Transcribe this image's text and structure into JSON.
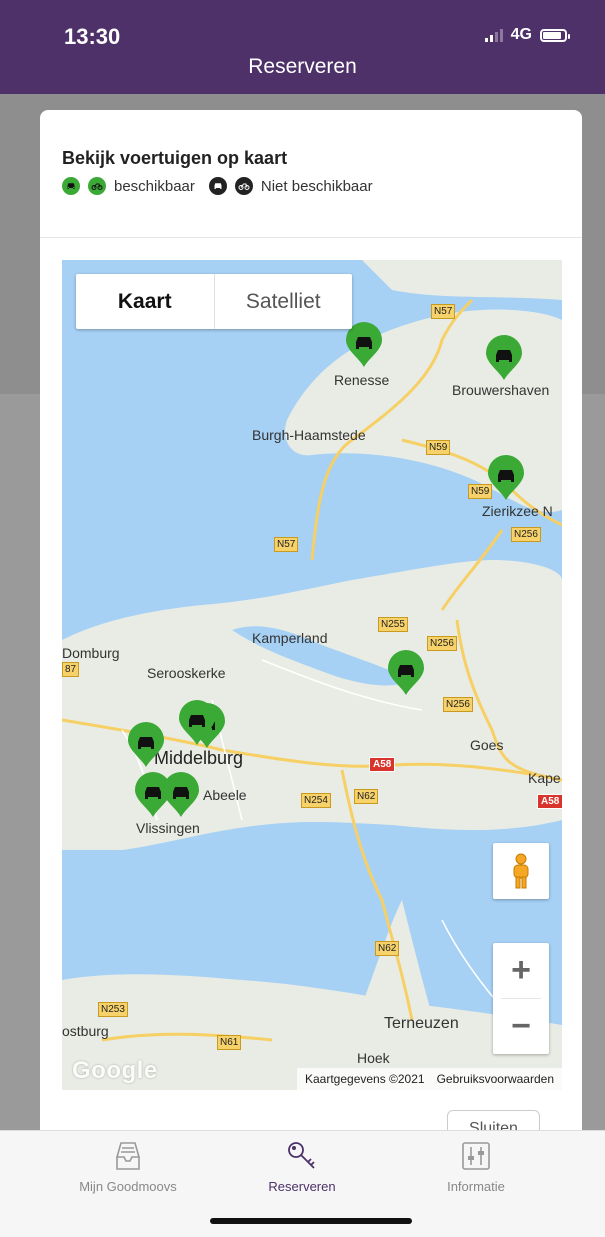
{
  "status_bar": {
    "time": "13:30",
    "network": "4G"
  },
  "nav": {
    "title": "Reserveren"
  },
  "card": {
    "title": "Bekijk voertuigen op kaart",
    "legend_available": "beschikbaar",
    "legend_unavailable": "Niet beschikbaar",
    "close_label": "Sluiten"
  },
  "map": {
    "type_map": "Kaart",
    "type_satellite": "Satelliet",
    "zoom_in": "+",
    "zoom_out": "−",
    "logo": "Google",
    "attribution": "Kaartgegevens ©2021",
    "terms": "Gebruiksvoorwaarden",
    "places": {
      "renesse": "Renesse",
      "brouwershaven": "Brouwershaven",
      "burgh": "Burgh-Haamstede",
      "zierikzee": "Zierikzee N",
      "kamperland": "Kamperland",
      "domburg": "Domburg",
      "serooskerke": "Serooskerke",
      "middelburg": "Middelburg",
      "goes": "Goes",
      "kape": "Kape",
      "abeele": "Abeele",
      "vlissingen": "Vlissingen",
      "terneuzen": "Terneuzen",
      "hoek": "Hoek",
      "ostburg": "ostburg"
    },
    "roads": {
      "n57a": "N57",
      "n57b": "N57",
      "n59a": "N59",
      "n59b": "N59",
      "n256a": "N256",
      "n256b": "N256",
      "n256c": "N256",
      "n255": "N255",
      "r87": "87",
      "a58a": "A58",
      "a58b": "A58",
      "n254": "N254",
      "n62a": "N62",
      "n62b": "N62",
      "n253": "N253",
      "n61": "N61"
    },
    "vehicle_status_color": "#3aa935"
  },
  "tabs": [
    {
      "label": "Mijn Goodmoovs",
      "icon": "inbox-icon"
    },
    {
      "label": "Reserveren",
      "icon": "key-icon"
    },
    {
      "label": "Informatie",
      "icon": "sliders-icon"
    }
  ],
  "colors": {
    "brand": "#4d3168",
    "water": "#a6d1f5",
    "land": "#e9ece4",
    "pin": "#3aa935"
  }
}
